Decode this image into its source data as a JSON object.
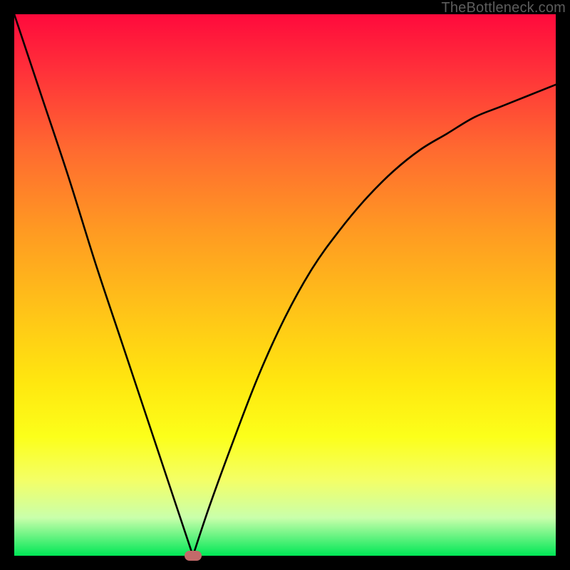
{
  "watermark": "TheBottleneck.com",
  "chart_data": {
    "type": "line",
    "title": "",
    "xlabel": "",
    "ylabel": "",
    "xlim": [
      0,
      100
    ],
    "ylim": [
      0,
      100
    ],
    "grid": false,
    "legend": false,
    "series": [
      {
        "name": "left-branch",
        "x": [
          0,
          5,
          10,
          15,
          20,
          25,
          30,
          33
        ],
        "values": [
          100,
          85,
          70,
          54,
          39,
          24,
          9,
          0
        ]
      },
      {
        "name": "right-branch",
        "x": [
          33,
          36,
          40,
          45,
          50,
          55,
          60,
          65,
          70,
          75,
          80,
          85,
          90,
          95,
          100
        ],
        "values": [
          0,
          9,
          20,
          33,
          44,
          53,
          60,
          66,
          71,
          75,
          78,
          81,
          83,
          85,
          87
        ]
      }
    ],
    "marker": {
      "x": 33,
      "y": 0,
      "color": "#c36a6a"
    },
    "background_gradient": {
      "top": "#ff0a3c",
      "middle": "#ffe70f",
      "bottom": "#00e756"
    }
  }
}
